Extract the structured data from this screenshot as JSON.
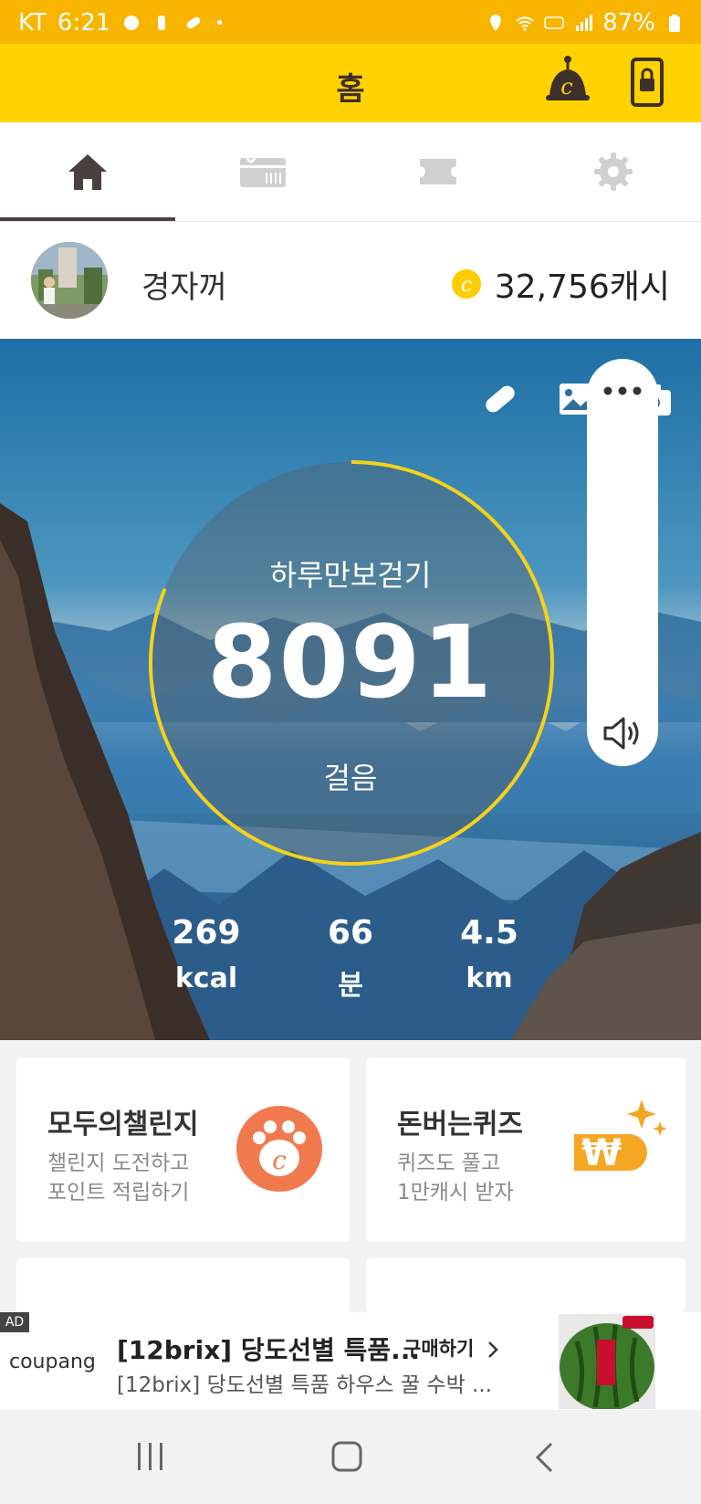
{
  "status_bar": {
    "carrier": "KT",
    "time": "6:21",
    "battery": "87%"
  },
  "header": {
    "title": "홈"
  },
  "tabs": [
    {
      "name": "home"
    },
    {
      "name": "gift"
    },
    {
      "name": "coupon"
    },
    {
      "name": "settings"
    }
  ],
  "profile": {
    "username": "경자꺼",
    "cash": "32,756캐시"
  },
  "hero": {
    "label": "하루만보걷기",
    "steps": "8091",
    "steps_unit": "걸음",
    "goal_progress": 0.81,
    "stats": [
      {
        "value": "269",
        "unit": "kcal"
      },
      {
        "value": "66",
        "unit": "분"
      },
      {
        "value": "4.5",
        "unit": "km"
      }
    ]
  },
  "cards": [
    {
      "title": "모두의챌린지",
      "subtitle1": "챌린지 도전하고",
      "subtitle2": "포인트 적립하기"
    },
    {
      "title": "돈버는퀴즈",
      "subtitle1": "퀴즈도 풀고",
      "subtitle2": "1만캐시 받자"
    }
  ],
  "ad": {
    "badge": "AD",
    "brand": "coupang",
    "title": "[12brix] 당도선별 특품...",
    "cta": "구매하기",
    "description": "[12brix] 당도선별 특품 하우스 꿀 수박 ..."
  },
  "colors": {
    "brand_yellow": "#ffd200",
    "status_yellow": "#f7b500",
    "ring_yellow": "#f5d21a",
    "challenge_orange": "#f07a4e",
    "quiz_orange": "#f5a623"
  }
}
